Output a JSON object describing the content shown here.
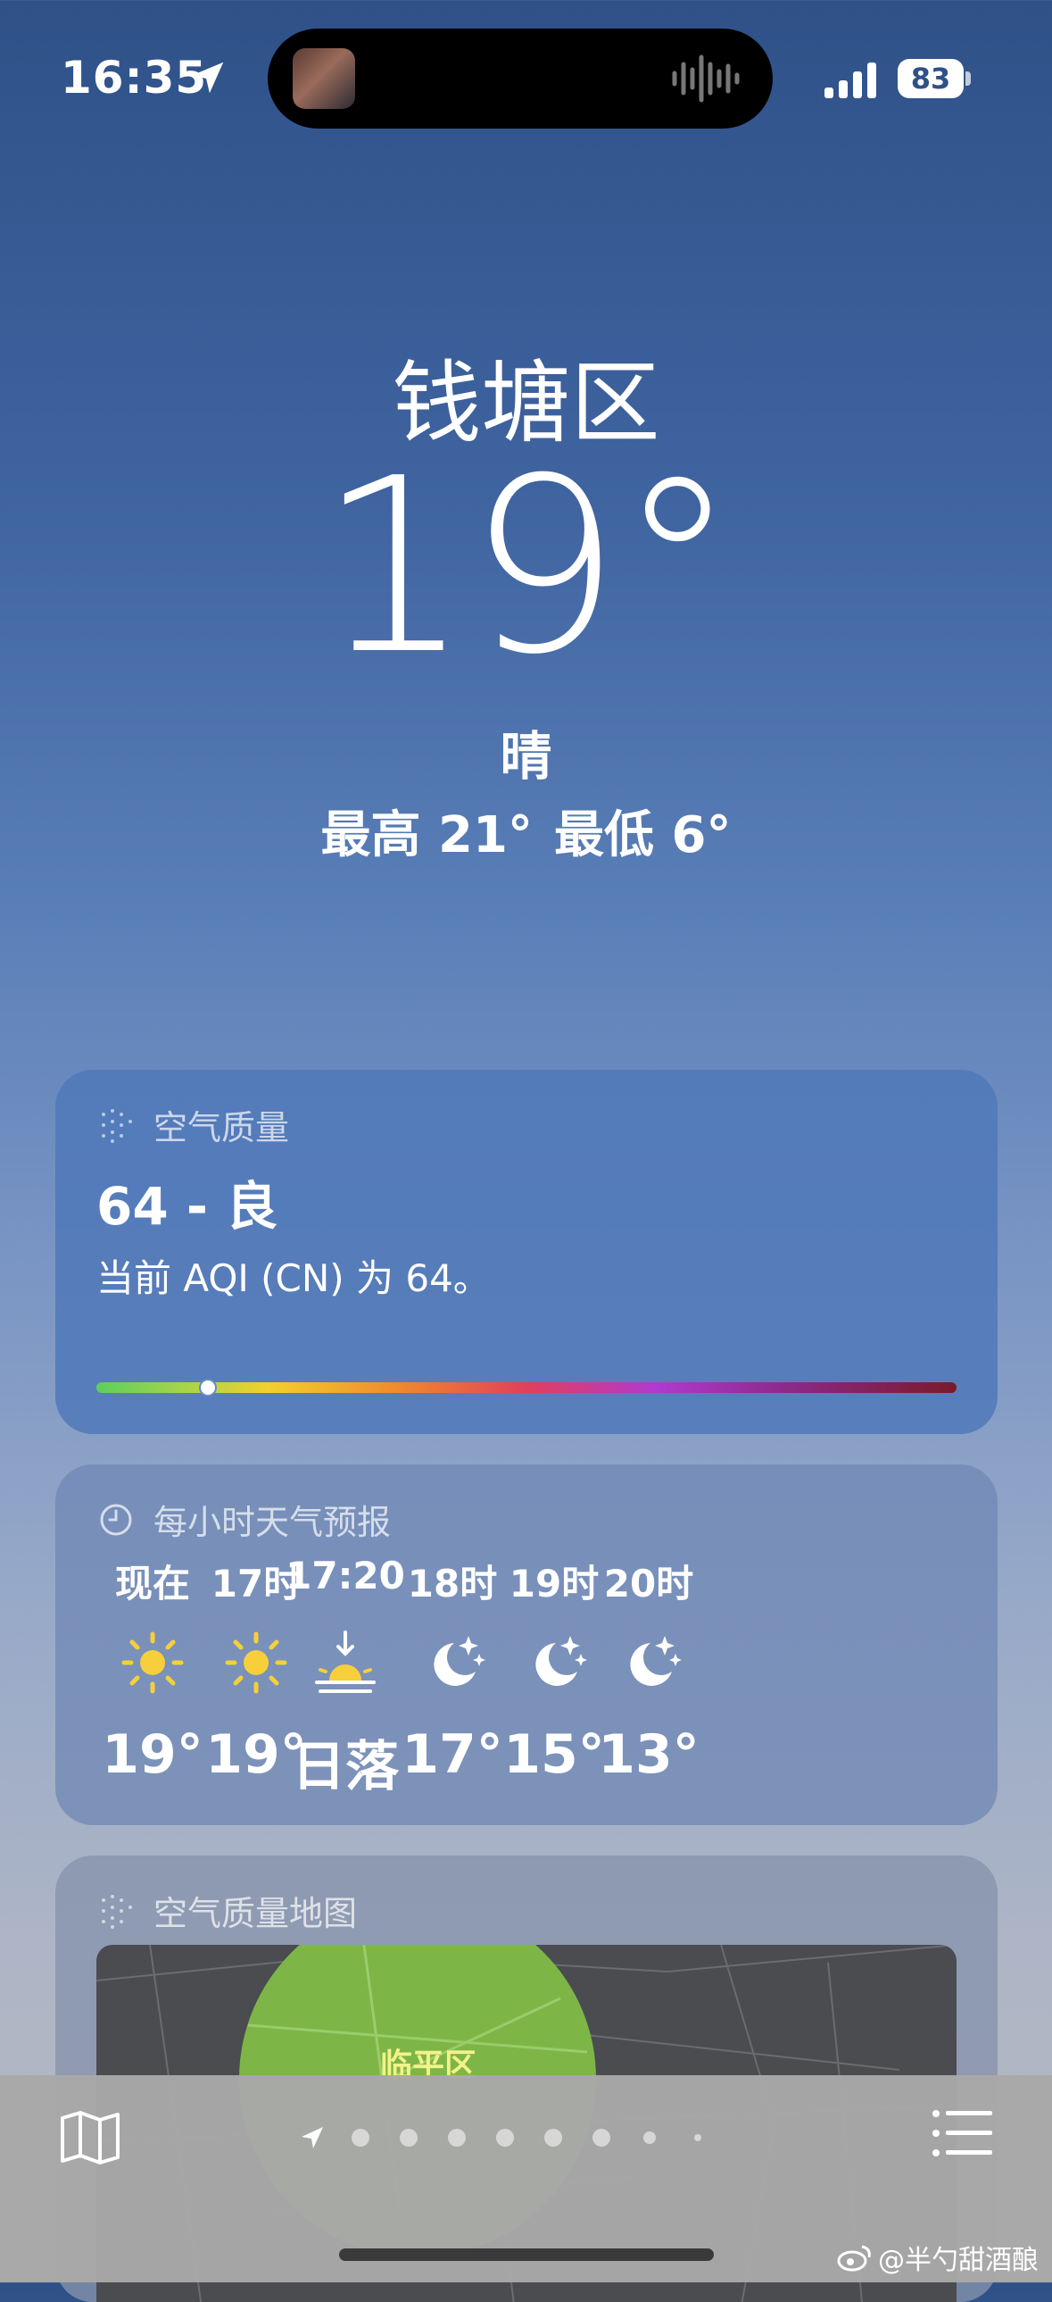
{
  "status_bar": {
    "time": "16:35",
    "battery": "83"
  },
  "hero": {
    "city": "钱塘区",
    "temperature": "19°",
    "condition": "晴",
    "high": "最高 21°",
    "low": "最低 6°"
  },
  "air_quality": {
    "title": "空气质量",
    "value": "64 - 良",
    "description": "当前 AQI (CN) 为 64。",
    "index_fraction": 0.13
  },
  "hourly": {
    "title": "每小时天气预报",
    "items": [
      {
        "label": "现在",
        "icon": "sun-icon",
        "temp": "19°"
      },
      {
        "label": "17时",
        "icon": "sun-icon",
        "temp": "19°"
      },
      {
        "label": "17:20",
        "icon": "sunset-icon",
        "temp": "日落"
      },
      {
        "label": "18时",
        "icon": "moon-stars-icon",
        "temp": "17°"
      },
      {
        "label": "19时",
        "icon": "moon-stars-icon",
        "temp": "15°"
      },
      {
        "label": "20时",
        "icon": "moon-stars-icon",
        "temp": "13°"
      }
    ]
  },
  "air_map": {
    "title": "空气质量地图",
    "district_label": "临平区"
  },
  "toolbar": {
    "page_count": 9,
    "current_page": 0
  },
  "watermark": "@半勺甜酒酿",
  "colors": {
    "sun": "#f6cf3a",
    "aqi_knob_border": "#5f8bd0",
    "map_green": "#7db646"
  }
}
